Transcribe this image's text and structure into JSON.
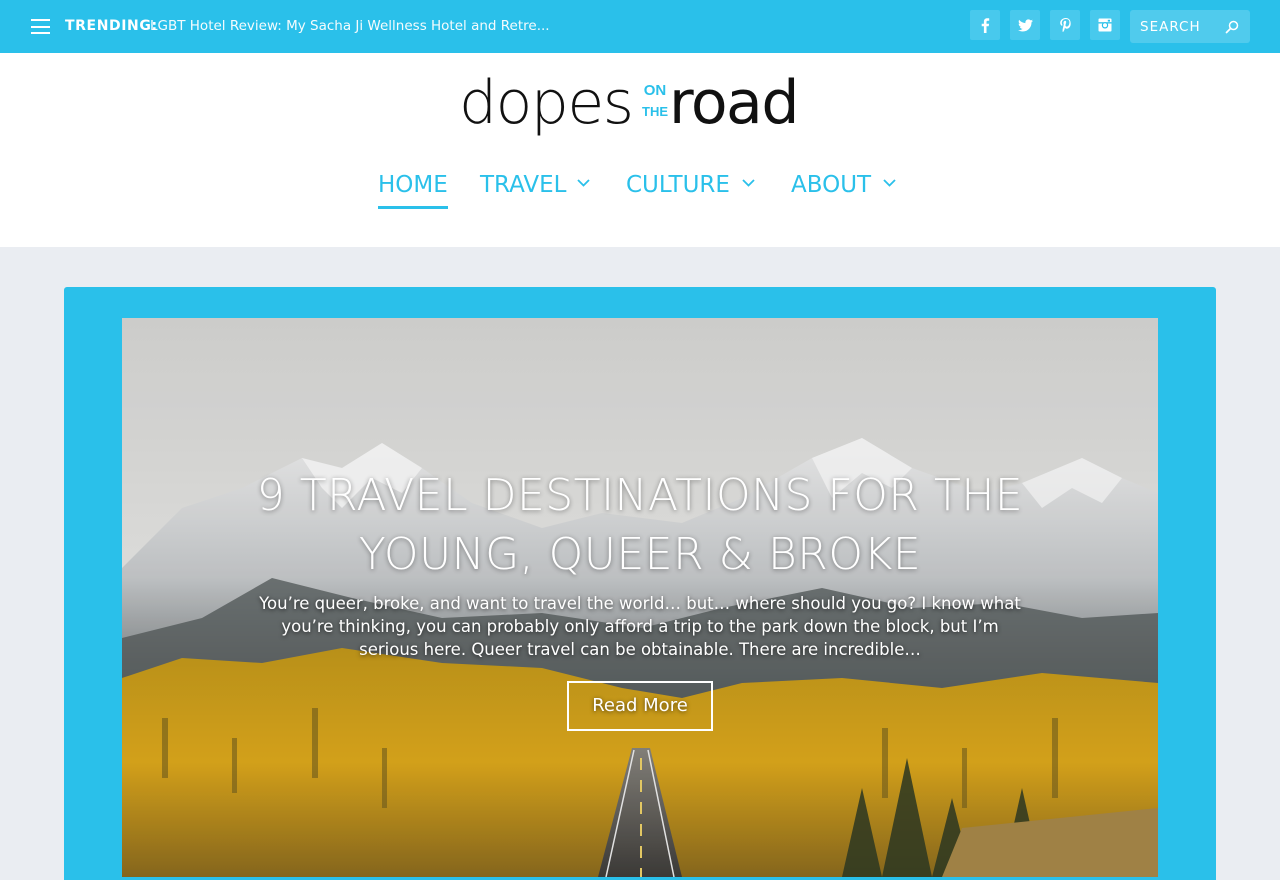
{
  "topbar": {
    "trending_label": "TRENDING:",
    "trending_text": "LGBT Hotel Review: My Sacha Ji Wellness Hotel and Retre...",
    "social": [
      "facebook-icon",
      "twitter-icon",
      "pinterest-icon",
      "instagram-icon"
    ],
    "search_placeholder": "SEARCH",
    "bg_color": "#2ac0ea"
  },
  "logo": {
    "part1": "dopes",
    "part2": "road",
    "on": "ON",
    "the": "THE",
    "accent_color": "#2ac0ea"
  },
  "nav": {
    "items": [
      {
        "label": "HOME",
        "active": true
      },
      {
        "label": "TRAVEL",
        "has_dropdown": true
      },
      {
        "label": "CULTURE",
        "has_dropdown": true
      },
      {
        "label": "ABOUT",
        "has_dropdown": true
      }
    ]
  },
  "featured": {
    "title": "9 Travel Destinations for the Young, Queer & Broke",
    "excerpt": "You’re queer, broke, and want to travel the world… but… where should you go? I know what you’re thinking, you can probably only afford a trip to the park down the block, but I’m serious here. Queer travel can be obtainable. There are incredible…",
    "read_more": "Read More"
  }
}
